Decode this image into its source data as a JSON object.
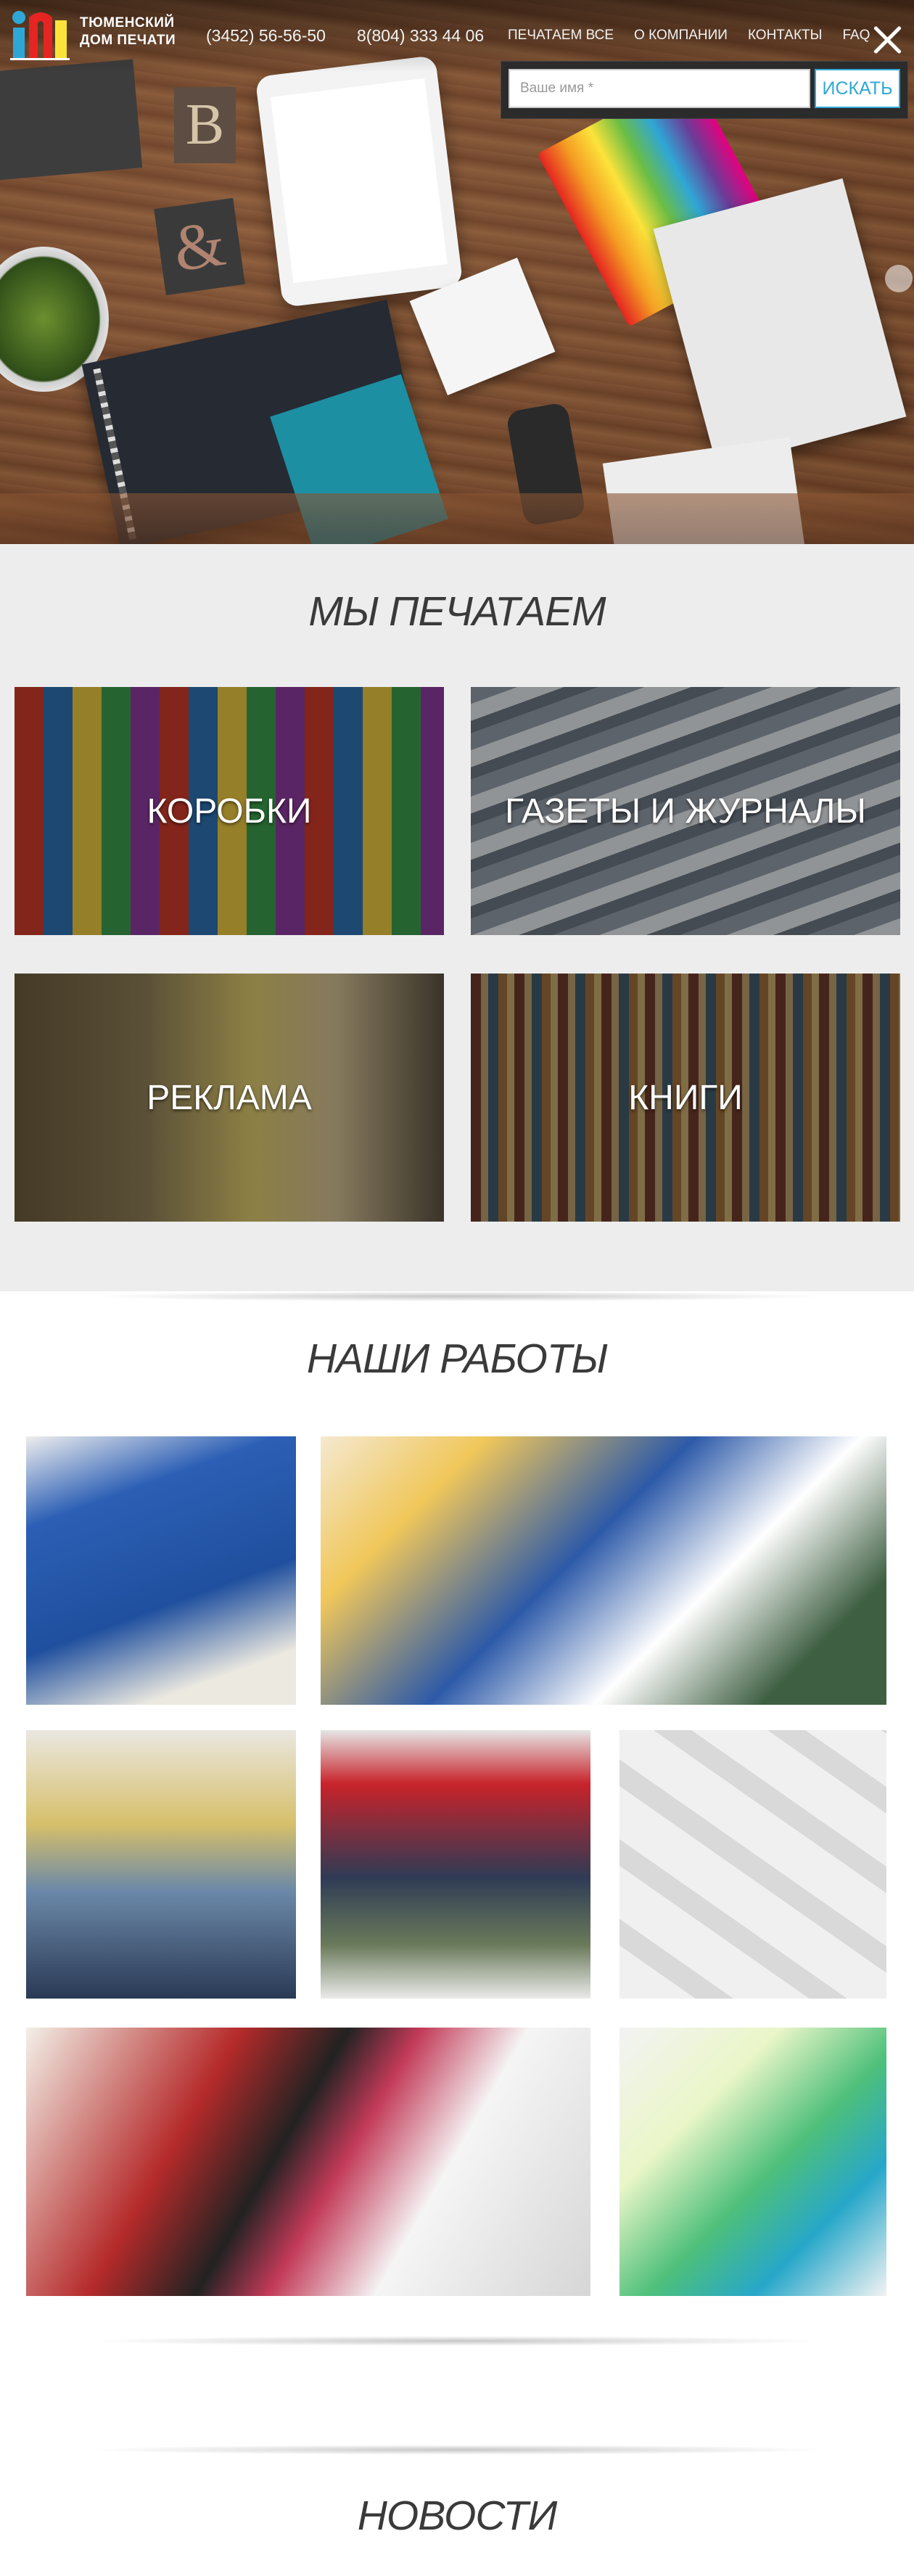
{
  "header": {
    "logo_line1": "ТЮМЕНСКИЙ",
    "logo_line2": "ДОМ ПЕЧАТИ",
    "phone1": "(3452) 56-56-50",
    "phone2": "8(804) 333 44 06",
    "nav": [
      "ПЕЧАТАЕМ ВСЕ",
      "О КОМПАНИИ",
      "КОНТАКТЫ",
      "FAQ"
    ]
  },
  "search": {
    "placeholder": "Ваше имя *",
    "button": "ИСКАТЬ"
  },
  "hero": {
    "letter_b": "B",
    "ampersand": "&"
  },
  "print_section": {
    "title": "МЫ ПЕЧАТАЕМ",
    "categories": [
      "КОРОБКИ",
      "ГАЗЕТЫ И ЖУРНАЛЫ",
      "РЕКЛАМА",
      "КНИГИ"
    ]
  },
  "works_section": {
    "title": "НАШИ РАБОТЫ"
  },
  "news_section": {
    "title": "НОВОСТИ"
  },
  "colors": {
    "accent": "#2fa7d6",
    "section_bg": "#ededed"
  }
}
